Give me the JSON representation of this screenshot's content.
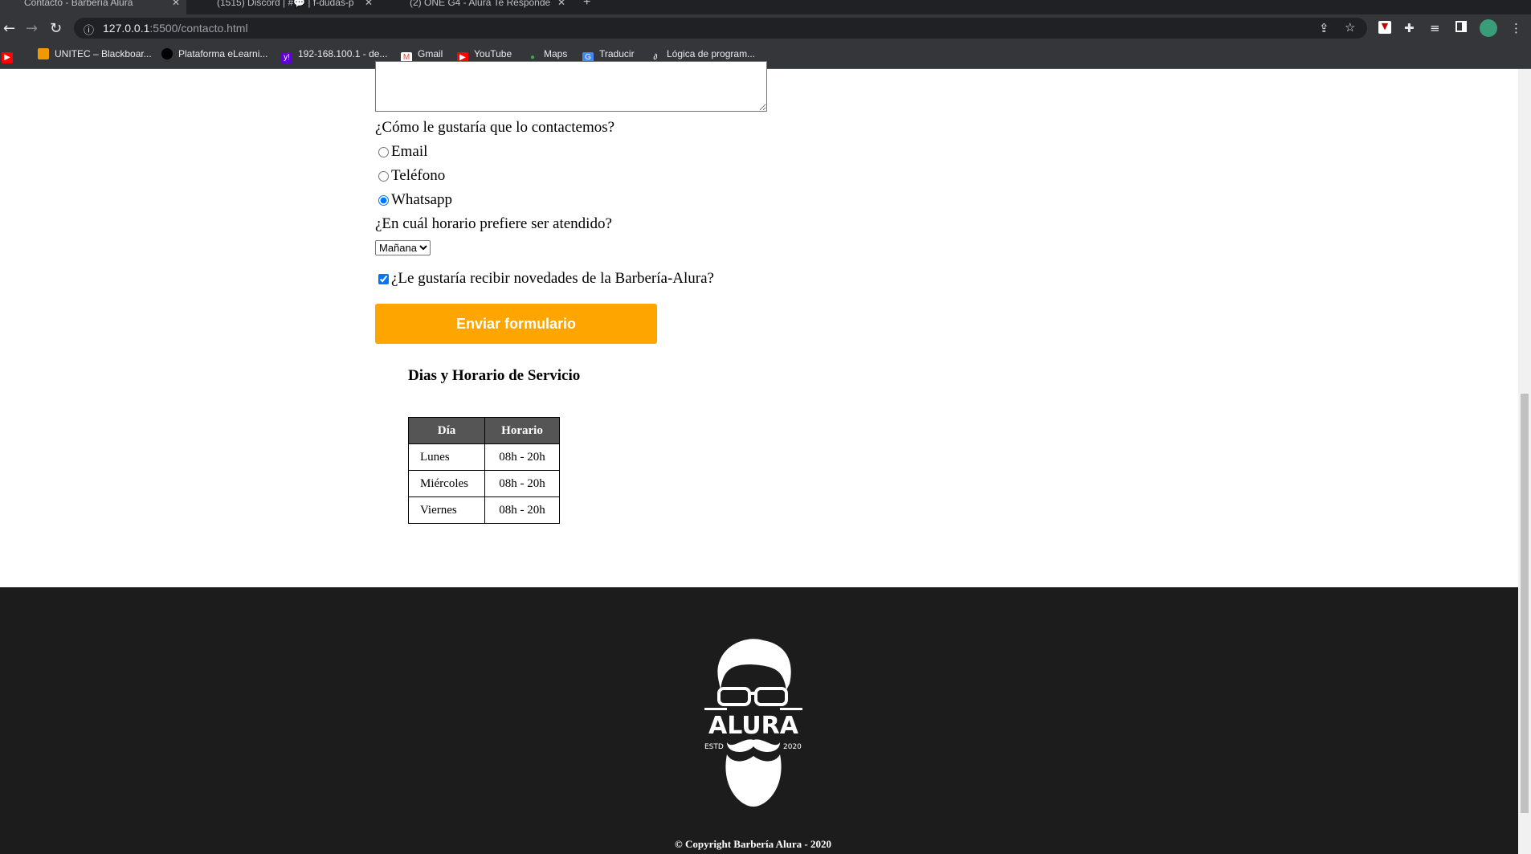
{
  "browser": {
    "tabs": [
      {
        "label": "Contacto - Barbería Alura",
        "active": true
      },
      {
        "label": "(1515) Discord | #💬 | f-dudas-p",
        "active": false
      },
      {
        "label": "(2) ONE G4 - Alura Te Responde",
        "active": false
      }
    ],
    "new_tab": "+",
    "url_host": "127.0.0.1",
    "url_rest": ":5500/contacto.html",
    "bookmarks": [
      {
        "label": "UNITEC – Blackboar...",
        "color": "#f29900"
      },
      {
        "label": "Plataforma eLearni...",
        "color": "#000000"
      },
      {
        "label": "192-168.100.1 - de...",
        "color": "#6001d2"
      },
      {
        "label": "Gmail",
        "color": "#ea4335"
      },
      {
        "label": "YouTube",
        "color": "#ff0000"
      },
      {
        "label": "Maps",
        "color": "#34a853"
      },
      {
        "label": "Traducir",
        "color": "#4285f4"
      },
      {
        "label": "Lógica de program...",
        "color": "#202124"
      }
    ]
  },
  "form": {
    "contact_question": "¿Cómo le gustaría que lo contactemos?",
    "options": [
      {
        "label": "Email",
        "checked": false
      },
      {
        "label": "Teléfono",
        "checked": false
      },
      {
        "label": "Whatsapp",
        "checked": true
      }
    ],
    "schedule_question": "¿En cuál horario prefiere ser atendido?",
    "schedule_selected": "Mañana",
    "newsletter_label": "¿Le gustaría recibir novedades de la Barbería-Alura?",
    "newsletter_checked": true,
    "submit_label": "Enviar formulario",
    "accent": "#ffa500"
  },
  "schedule": {
    "title": "Dias y Horario de Servicio",
    "headers": [
      "Día",
      "Horario"
    ],
    "rows": [
      [
        "Lunes",
        "08h - 20h"
      ],
      [
        "Miércoles",
        "08h - 20h"
      ],
      [
        "Viernes",
        "08h - 20h"
      ]
    ]
  },
  "footer": {
    "logo_text": "ALURA",
    "logo_left": "ESTD",
    "logo_right": "2020",
    "copyright": "© Copyright Barbería Alura - 2020"
  }
}
